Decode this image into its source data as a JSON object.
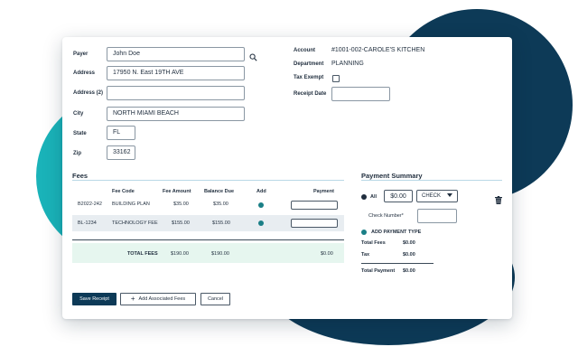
{
  "form": {
    "payer_label": "Payer",
    "payer_value": "John Doe",
    "address_label": "Address",
    "address_value": "17950 N. East 19TH AVE",
    "address2_label": "Address (2)",
    "address2_value": "",
    "city_label": "City",
    "city_value": "NORTH MIAMI BEACH",
    "state_label": "State",
    "state_value": "FL",
    "zip_label": "Zip",
    "zip_value": "33162",
    "account_label": "Account",
    "account_value": "#1001-002-CAROLE'S KITCHEN",
    "department_label": "Department",
    "department_value": "PLANNING",
    "tax_exempt_label": "Tax Exempt",
    "tax_exempt_checked": false,
    "receipt_date_label": "Receipt Date",
    "receipt_date_value": ""
  },
  "fees": {
    "title": "Fees",
    "headers": {
      "fee_code": "Fee Code",
      "fee_amount": "Fee Amount",
      "balance_due": "Balance Due",
      "add": "Add",
      "payment": "Payment"
    },
    "rows": [
      {
        "id": "B2022-242",
        "code": "BUILDING PLAN",
        "amount": "$35.00",
        "balance": "$35.00",
        "add": true,
        "payment": ""
      },
      {
        "id": "BL-1234",
        "code": "TECHNOLOGY FEE",
        "amount": "$155.00",
        "balance": "$155.00",
        "add": true,
        "payment": ""
      }
    ],
    "total": {
      "label": "TOTAL FEES",
      "amount": "$190.00",
      "balance": "$190.00",
      "payment": "$0.00"
    }
  },
  "payment_summary": {
    "title": "Payment Summary",
    "all_label": "All",
    "amount_value": "$0.00",
    "method_value": "CHECK",
    "check_number_label": "Check Number*",
    "check_number_value": "",
    "add_payment_label": "ADD PAYMENT TYPE",
    "total_fees_label": "Total Fees",
    "total_fees_value": "$0.00",
    "tax_label": "Tax",
    "tax_value": "$0.00",
    "total_payment_label": "Total Payment",
    "total_payment_value": "$0.00"
  },
  "buttons": {
    "save": "Save Receipt",
    "add_fees": "Add Associated Fees",
    "cancel": "Cancel"
  },
  "colors": {
    "primary": "#0d3a57",
    "teal": "#1ab3b9",
    "dot": "#1a7f86",
    "row_highlight": "#e8edf1",
    "total_row": "#e6f6ef"
  },
  "icons": {
    "search": "search-icon",
    "caret": "caret-down-icon",
    "trash": "trash-icon",
    "plus": "plus-icon"
  }
}
